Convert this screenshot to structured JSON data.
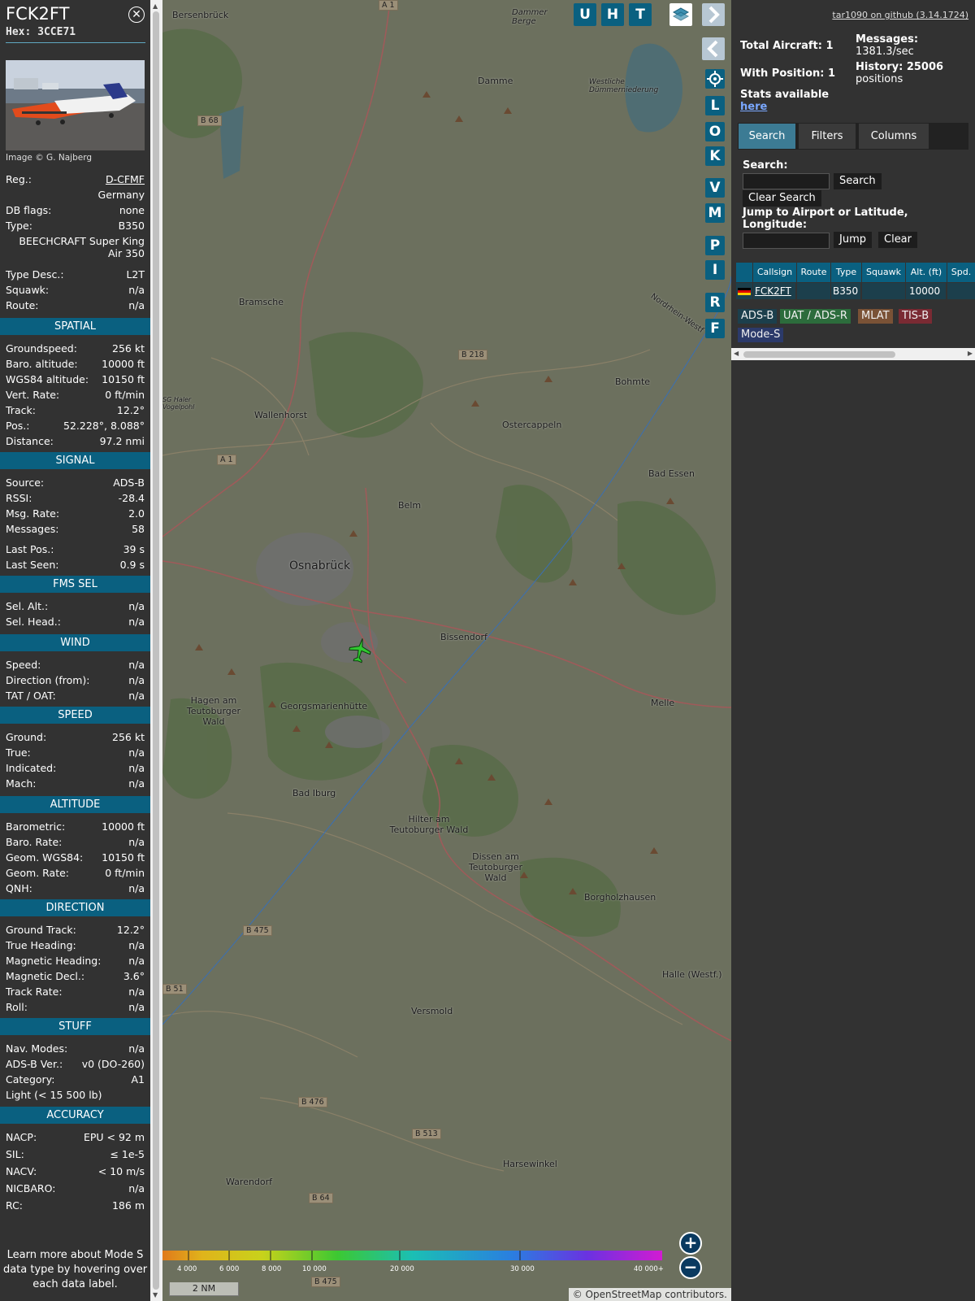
{
  "info": {
    "callsign": "FCK2FT",
    "hex": "Hex:  3CCE71",
    "image_credit": "Image © G. Najberg",
    "rows_top": [
      {
        "label": "Reg.:",
        "value": "D-CFMF",
        "link": true
      },
      {
        "label": "",
        "value": "Germany"
      },
      {
        "label": "DB flags:",
        "value": "none"
      },
      {
        "label": "Type:",
        "value": "B350"
      },
      {
        "label": "",
        "value": "BEECHCRAFT Super King Air 350",
        "multiline": true
      },
      {
        "label": "Type Desc.:",
        "value": "L2T"
      },
      {
        "label": "Squawk:",
        "value": "n/a"
      },
      {
        "label": "Route:",
        "value": "n/a"
      }
    ],
    "sections": [
      {
        "title": "SPATIAL",
        "rows": [
          {
            "label": "Groundspeed:",
            "value": "256 kt"
          },
          {
            "label": "Baro. altitude:",
            "value": "10000 ft"
          },
          {
            "label": "WGS84 altitude:",
            "value": "10150 ft"
          },
          {
            "label": "Vert. Rate:",
            "value": "0 ft/min"
          },
          {
            "label": "Track:",
            "value": "12.2°"
          },
          {
            "label": "Pos.:",
            "value": "52.228°, 8.088°"
          },
          {
            "label": "Distance:",
            "value": "97.2 nmi"
          }
        ]
      },
      {
        "title": "SIGNAL",
        "rows": [
          {
            "label": "Source:",
            "value": "ADS-B"
          },
          {
            "label": "RSSI:",
            "value": "-28.4"
          },
          {
            "label": "Msg. Rate:",
            "value": "2.0"
          },
          {
            "label": "Messages:",
            "value": "58"
          },
          {
            "label": "Last Pos.:",
            "value": "39 s"
          },
          {
            "label": "Last Seen:",
            "value": "0.9 s"
          }
        ]
      },
      {
        "title": "FMS SEL",
        "rows": [
          {
            "label": "Sel. Alt.:",
            "value": "n/a"
          },
          {
            "label": "Sel. Head.:",
            "value": "n/a"
          }
        ]
      },
      {
        "title": "WIND",
        "rows": [
          {
            "label": "Speed:",
            "value": "n/a"
          },
          {
            "label": "Direction (from):",
            "value": "n/a"
          },
          {
            "label": "TAT / OAT:",
            "value": "n/a"
          }
        ]
      },
      {
        "title": "SPEED",
        "rows": [
          {
            "label": "Ground:",
            "value": "256 kt"
          },
          {
            "label": "True:",
            "value": "n/a"
          },
          {
            "label": "Indicated:",
            "value": "n/a"
          },
          {
            "label": "Mach:",
            "value": "n/a"
          }
        ]
      },
      {
        "title": "ALTITUDE",
        "rows": [
          {
            "label": "Barometric:",
            "value": "10000 ft"
          },
          {
            "label": "Baro. Rate:",
            "value": "n/a"
          },
          {
            "label": "Geom. WGS84:",
            "value": "10150 ft"
          },
          {
            "label": "Geom. Rate:",
            "value": "0 ft/min"
          },
          {
            "label": "QNH:",
            "value": "n/a"
          }
        ]
      },
      {
        "title": "DIRECTION",
        "rows": [
          {
            "label": "Ground Track:",
            "value": "12.2°"
          },
          {
            "label": "True Heading:",
            "value": "n/a"
          },
          {
            "label": "Magnetic Heading:",
            "value": "n/a"
          },
          {
            "label": "Magnetic Decl.:",
            "value": "3.6°"
          },
          {
            "label": "Track Rate:",
            "value": "n/a"
          },
          {
            "label": "Roll:",
            "value": "n/a"
          }
        ]
      },
      {
        "title": "STUFF",
        "rows": [
          {
            "label": "Nav. Modes:",
            "value": "n/a"
          },
          {
            "label": "ADS-B Ver.:",
            "value": "v0 (DO-260)"
          },
          {
            "label": "Category:",
            "value": "A1"
          },
          {
            "label": "Light (< 15 500 lb)",
            "value": ""
          }
        ]
      },
      {
        "title": "ACCURACY",
        "rows": [
          {
            "label": "NACP:",
            "value": "EPU < 92 m"
          },
          {
            "label": "SIL:",
            "value": "≤ 1e-5"
          },
          {
            "label": "NACV:",
            "value": "< 10 m/s"
          },
          {
            "label": "NICBARO:",
            "value": "n/a"
          },
          {
            "label": "RC:",
            "value": "186 m"
          }
        ]
      }
    ],
    "footnote": "Learn more about Mode S data type by hovering over each data label."
  },
  "map": {
    "buttons_top": [
      "U",
      "H",
      "T"
    ],
    "buttons_side": [
      "L",
      "O",
      "K",
      "V",
      "M",
      "P",
      "I",
      "R",
      "F"
    ],
    "places": [
      "Bersenbrück",
      "Damme",
      "Dammer Berge",
      "Westliche Dümmerniederung",
      "Bramsche",
      "Wallenhorst",
      "Ostercappeln",
      "Bohmte",
      "Bad Essen",
      "Belm",
      "Osnabrück",
      "Bissendorf",
      "Hagen am Teutoburger Wald",
      "Georgsmarienhütte",
      "Melle",
      "Bad Iburg",
      "Hilter am Teutoburger Wald",
      "Dissen am Teutoburger Wald",
      "Borgholzhausen",
      "Halle (Westf.)",
      "Versmold",
      "Harsewinkel",
      "Warendorf",
      "Nordrhein-Westf",
      "SG Haler Vogelpohl"
    ],
    "roads": [
      "A 1",
      "B 68",
      "B 218",
      "B 475",
      "B 51",
      "B 476",
      "B 513",
      "B 64",
      "B 475",
      "A 1"
    ],
    "scale": "2 NM",
    "altitude_legend": [
      "4 000",
      "6 000",
      "8 000",
      "10 000",
      "20 000",
      "30 000",
      "40 000+"
    ],
    "attribution": "© OpenStreetMap contributors."
  },
  "sidebar": {
    "version": "tar1090 on github (3.14.1724)",
    "total_aircraft": "Total Aircraft: 1",
    "with_position": "With Position: 1",
    "messages_label": "Messages:",
    "messages_value": "1381.3/sec",
    "history_label": "History: 25006",
    "history_value": "positions",
    "stats": "Stats available",
    "stats_link": "here",
    "tabs": [
      "Search",
      "Filters",
      "Columns"
    ],
    "search_label": "Search:",
    "search_button": "Search",
    "clear_search_button": "Clear Search",
    "jump_label": "Jump to Airport or Latitude, Longitude:",
    "jump_button": "Jump",
    "clear_button": "Clear",
    "table_headers": [
      "Callsign",
      "Route",
      "Type",
      "Squawk",
      "Alt. (ft)",
      "Spd."
    ],
    "table_row": {
      "callsign": "FCK2FT",
      "route": "",
      "type": "B350",
      "squawk": "",
      "alt": "10000"
    },
    "legend": [
      {
        "label": "ADS-B",
        "color": "#1c3f4c"
      },
      {
        "label": "UAT / ADS-R",
        "color": "#2c6c3c"
      },
      {
        "label": "MLAT",
        "color": "#7a5236"
      },
      {
        "label": "TIS-B",
        "color": "#7a2a33"
      },
      {
        "label": "Mode-S",
        "color": "#2b3a6a"
      }
    ]
  },
  "colors": {
    "accent": "#0a6080",
    "aircraft": "#31c831"
  }
}
